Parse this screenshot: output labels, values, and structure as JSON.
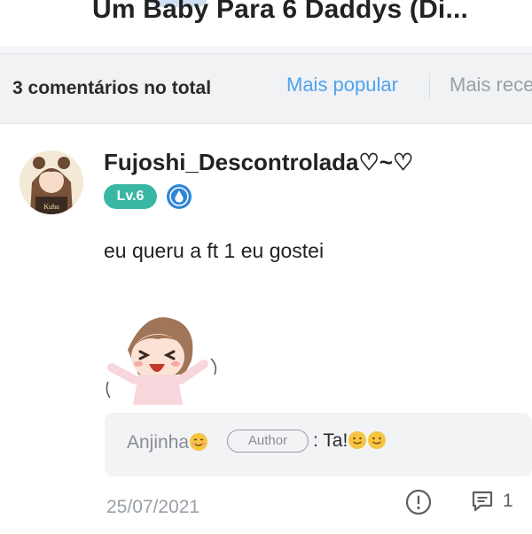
{
  "header": {
    "title": "Um Baby Para 6 Daddys (Di..."
  },
  "filter": {
    "count_label": "3 comentários no total",
    "sort_popular": "Mais popular",
    "sort_recent": "Mais rece",
    "active_color": "#4ea3ee"
  },
  "comment": {
    "username": "Fujoshi_Descontrolada♡~♡",
    "level": "Lv.6",
    "text": "eu queru a ft 1 eu gostei",
    "date": "25/07/2021",
    "reply_count": "1",
    "reply": {
      "name": "Anjinha",
      "author_tag": "Author",
      "message": ": Ta!"
    }
  },
  "icons": {
    "avatar": "anime-girl-avatar",
    "member_badge": "blue-drop-badge-icon",
    "sticker": "happy-chibi-sticker",
    "report": "exclamation-circle-icon",
    "reply": "comment-bubble-icon",
    "emoji": "smiling-face-emoji"
  }
}
